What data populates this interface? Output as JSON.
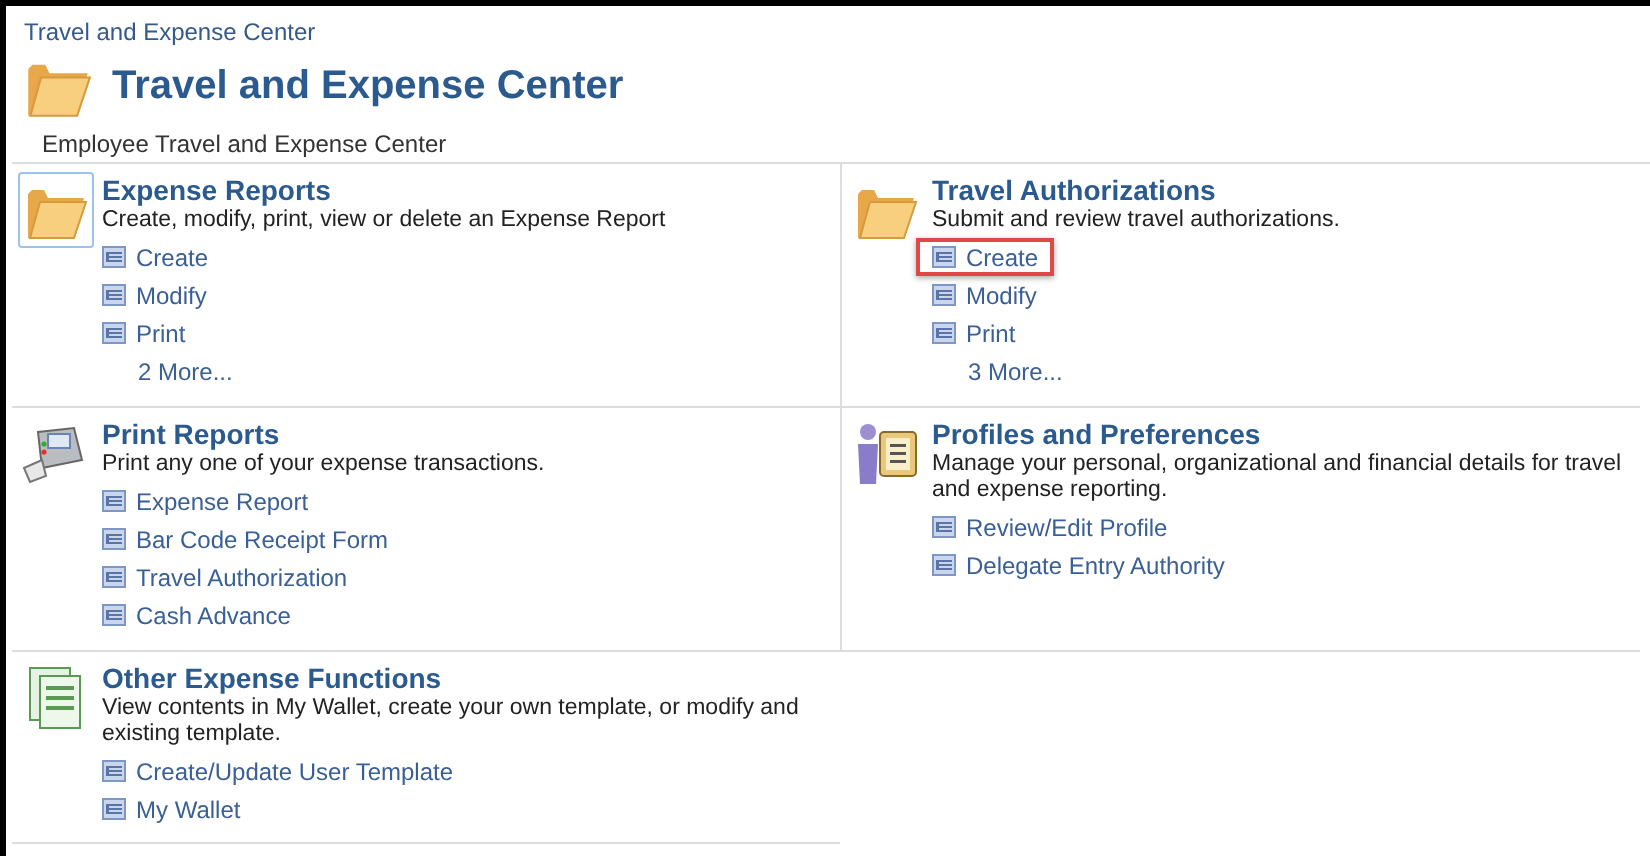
{
  "breadcrumb": "Travel and Expense Center",
  "title": "Travel and Expense Center",
  "subtitle": "Employee Travel and Expense Center",
  "sections": [
    {
      "kind": "folder",
      "focused": true,
      "title": "Expense Reports",
      "description": "Create, modify, print, view or delete an Expense Report",
      "links": [
        {
          "kind": "link",
          "label": "Create",
          "highlighted": false
        },
        {
          "kind": "link",
          "label": "Modify",
          "highlighted": false
        },
        {
          "kind": "link",
          "label": "Print",
          "highlighted": false
        },
        {
          "kind": "more",
          "label": "2 More...",
          "highlighted": false
        }
      ]
    },
    {
      "kind": "folder",
      "focused": false,
      "title": "Travel Authorizations",
      "description": "Submit and review travel authorizations.",
      "links": [
        {
          "kind": "link",
          "label": "Create",
          "highlighted": true
        },
        {
          "kind": "link",
          "label": "Modify",
          "highlighted": false
        },
        {
          "kind": "link",
          "label": "Print",
          "highlighted": false
        },
        {
          "kind": "more",
          "label": "3 More...",
          "highlighted": false
        }
      ]
    },
    {
      "kind": "printer",
      "focused": false,
      "title": "Print Reports",
      "description": "Print any one of your expense transactions.",
      "links": [
        {
          "kind": "link",
          "label": "Expense Report",
          "highlighted": false
        },
        {
          "kind": "link",
          "label": "Bar Code Receipt Form",
          "highlighted": false
        },
        {
          "kind": "link",
          "label": "Travel Authorization",
          "highlighted": false
        },
        {
          "kind": "link",
          "label": "Cash Advance",
          "highlighted": false
        }
      ]
    },
    {
      "kind": "person",
      "focused": false,
      "title": "Profiles and Preferences",
      "description": "Manage your personal, organizational and financial details for travel and expense reporting.",
      "links": [
        {
          "kind": "link",
          "label": "Review/Edit Profile",
          "highlighted": false
        },
        {
          "kind": "link",
          "label": "Delegate Entry Authority",
          "highlighted": false
        }
      ]
    },
    {
      "kind": "documents",
      "focused": false,
      "title": "Other Expense Functions",
      "description": "View contents in My Wallet, create your own template, or modify and existing template.",
      "links": [
        {
          "kind": "link",
          "label": "Create/Update User Template",
          "highlighted": false
        },
        {
          "kind": "link",
          "label": "My Wallet",
          "highlighted": false
        }
      ]
    }
  ]
}
